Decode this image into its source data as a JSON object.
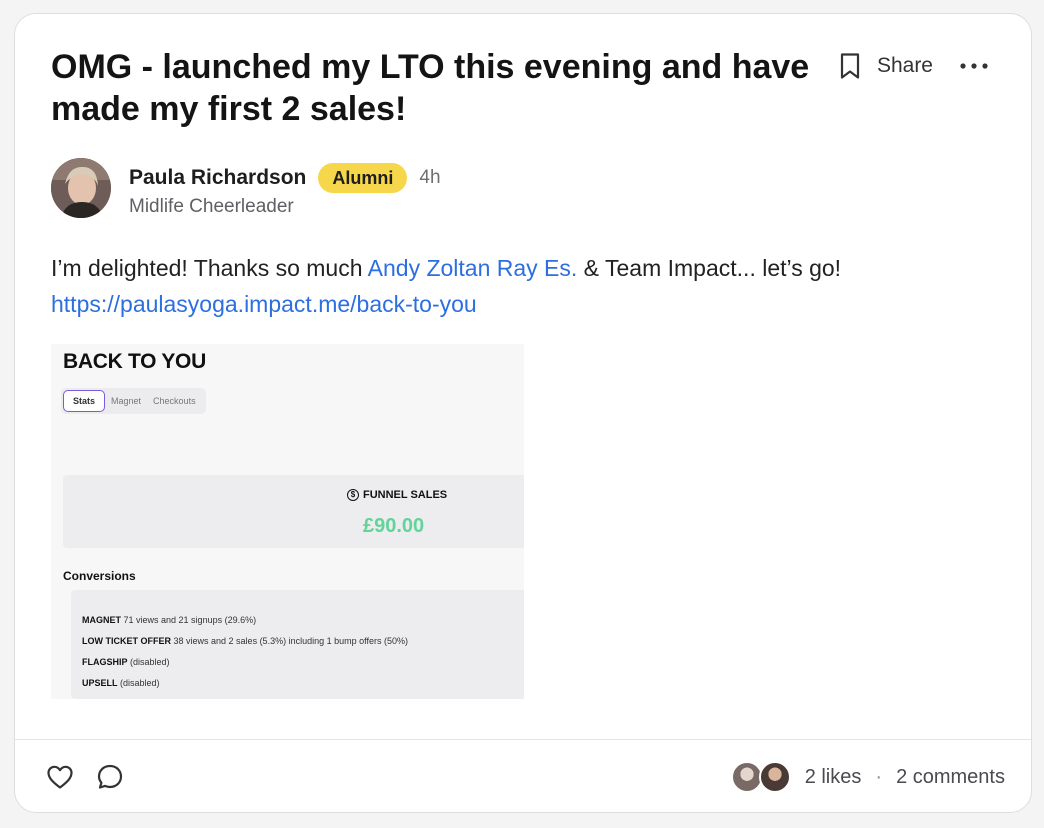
{
  "post": {
    "title": "OMG - launched my LTO this evening and have made my first 2 sales!",
    "share_label": "Share",
    "author": {
      "name": "Paula Richardson",
      "badge": "Alumni",
      "time": "4h",
      "subtitle": "Midlife Cheerleader"
    },
    "body": {
      "text_before": "I’m delighted! Thanks so much ",
      "mention": "Andy Zoltan Ray Es.",
      "text_after": "  & Team Impact... let’s go!",
      "link": "https://paulasyoga.impact.me/back-to-you"
    },
    "attachment": {
      "title": "BACK TO YOU",
      "tabs": [
        "Stats",
        "Magnet",
        "Checkouts"
      ],
      "funnel_label": "FUNNEL SALES",
      "funnel_value": "£90.00",
      "conversions_title": "Conversions",
      "conversions": [
        {
          "label": "MAGNET",
          "detail": "71 views and 21 signups (29.6%)"
        },
        {
          "label": "LOW TICKET OFFER",
          "detail": "38 views and 2 sales (5.3%) including 1 bump offers (50%)"
        },
        {
          "label": "FLAGSHIP",
          "detail": "(disabled)"
        },
        {
          "label": "UPSELL",
          "detail": "(disabled)"
        }
      ]
    },
    "footer": {
      "likes": "2 likes",
      "separator": "·",
      "comments": "2 comments"
    }
  },
  "icons": {
    "bookmark": "bookmark-icon",
    "more": "more-icon",
    "like": "heart-icon",
    "comment": "comment-icon"
  },
  "colors": {
    "link": "#2d6ee0",
    "badge": "#f6d64a",
    "funnel_value": "#63d39a",
    "active_tab": "#7a5be0"
  }
}
